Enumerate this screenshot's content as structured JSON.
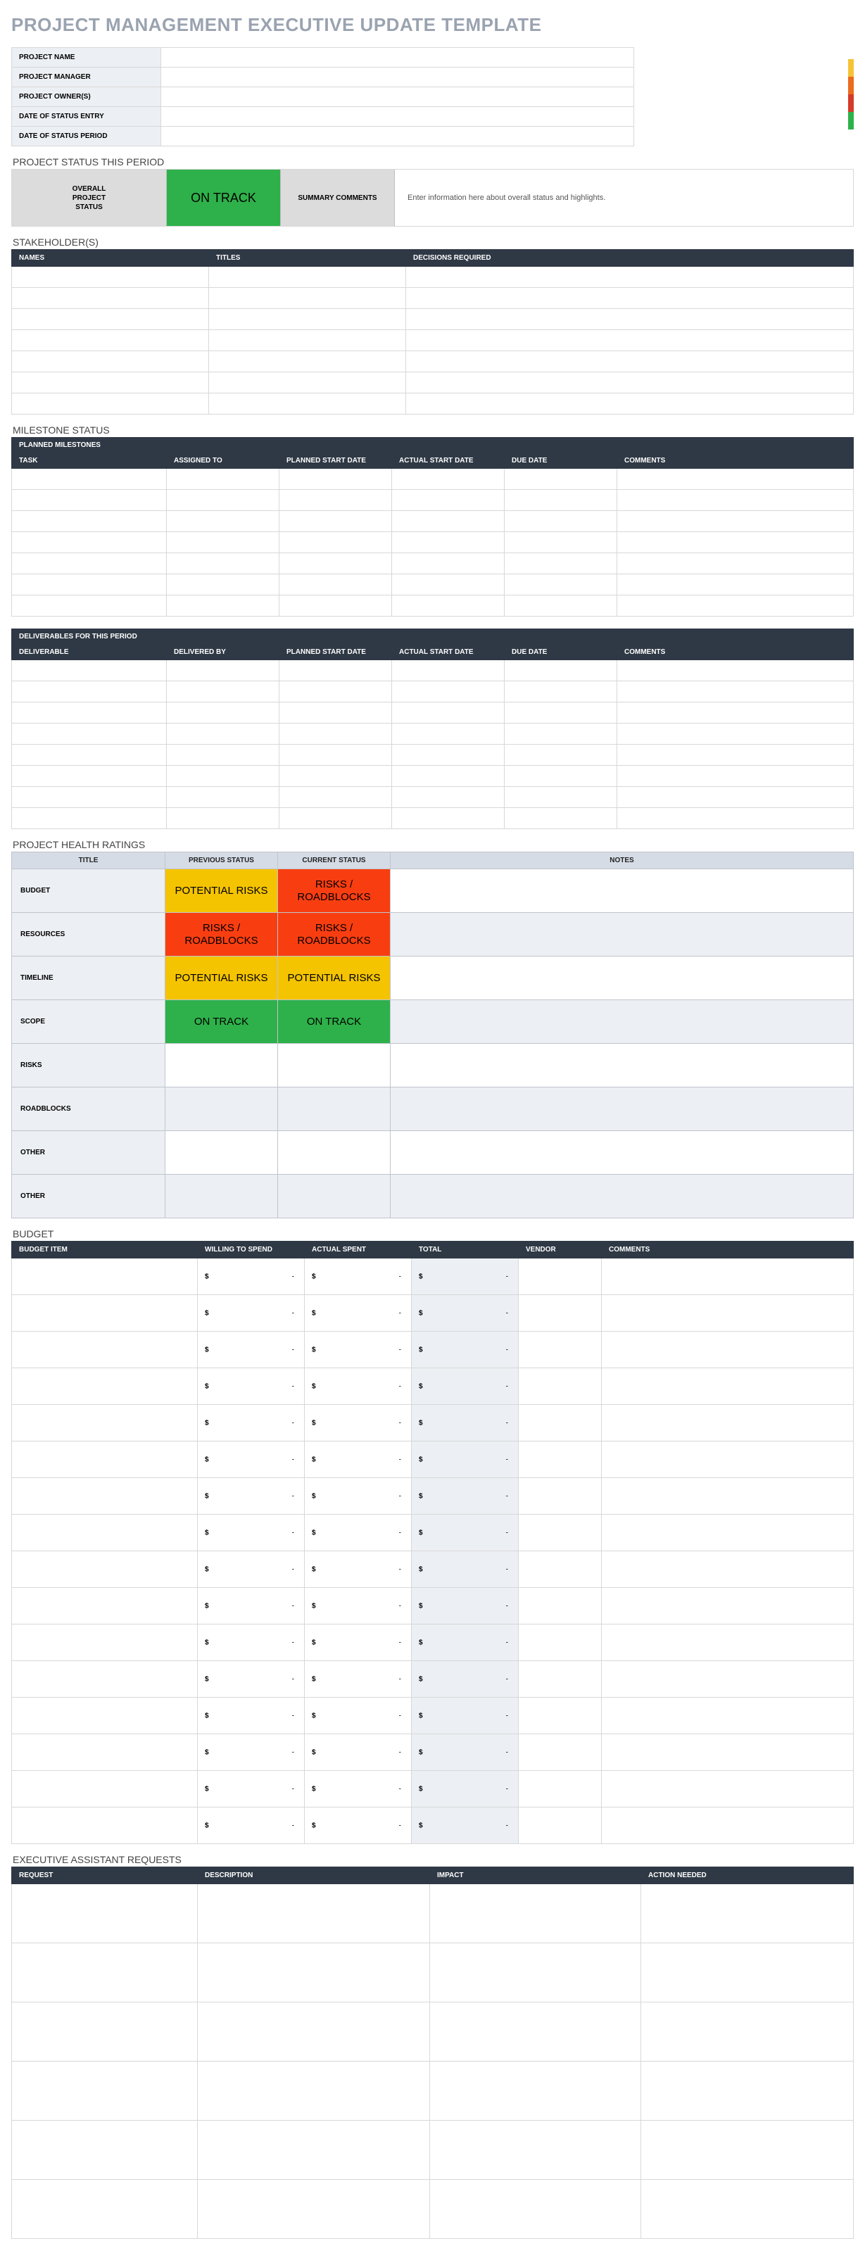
{
  "title": "PROJECT MANAGEMENT EXECUTIVE UPDATE TEMPLATE",
  "info": {
    "rows": [
      {
        "label": "PROJECT NAME",
        "value": ""
      },
      {
        "label": "PROJECT MANAGER",
        "value": ""
      },
      {
        "label": "PROJECT OWNER(S)",
        "value": ""
      },
      {
        "label": "DATE OF STATUS ENTRY",
        "value": ""
      },
      {
        "label": "DATE OF STATUS PERIOD",
        "value": ""
      }
    ]
  },
  "status_period": {
    "label": "PROJECT STATUS THIS PERIOD",
    "overall_label": "OVERALL\nPROJECT\nSTATUS",
    "status_text": "ON TRACK",
    "status_class": "green",
    "summary_label": "SUMMARY COMMENTS",
    "summary_value": "Enter information here about overall status and highlights."
  },
  "stakeholders": {
    "label": "STAKEHOLDER(S)",
    "headers": [
      "NAMES",
      "TITLES",
      "DECISIONS REQUIRED"
    ],
    "widths": [
      "280px",
      "280px",
      "auto"
    ],
    "rows": 7
  },
  "milestones": {
    "label": "MILESTONE STATUS",
    "subheads": {
      "planned": "PLANNED MILESTONES",
      "deliv": "DELIVERABLES FOR THIS PERIOD"
    },
    "headers_planned": [
      "TASK",
      "ASSIGNED TO",
      "PLANNED START DATE",
      "ACTUAL START DATE",
      "DUE DATE",
      "COMMENTS"
    ],
    "headers_deliv": [
      "DELIVERABLE",
      "DELIVERED BY",
      "PLANNED START DATE",
      "ACTUAL START DATE",
      "DUE DATE",
      "COMMENTS"
    ],
    "widths": [
      "220px",
      "160px",
      "160px",
      "160px",
      "160px",
      "auto"
    ],
    "rows_planned": 7,
    "rows_deliv": 8
  },
  "health": {
    "label": "PROJECT HEALTH RATINGS",
    "headers": [
      "TITLE",
      "PREVIOUS STATUS",
      "CURRENT STATUS",
      "NOTES"
    ],
    "rows": [
      {
        "title": "BUDGET",
        "prev": "POTENTIAL RISKS",
        "prev_class": "yellow",
        "curr": "RISKS / ROADBLOCKS",
        "curr_class": "red",
        "alt": false
      },
      {
        "title": "RESOURCES",
        "prev": "RISKS / ROADBLOCKS",
        "prev_class": "red",
        "curr": "RISKS / ROADBLOCKS",
        "curr_class": "red",
        "alt": true
      },
      {
        "title": "TIMELINE",
        "prev": "POTENTIAL RISKS",
        "prev_class": "yellow",
        "curr": "POTENTIAL RISKS",
        "curr_class": "yellow",
        "alt": false
      },
      {
        "title": "SCOPE",
        "prev": "ON TRACK",
        "prev_class": "green",
        "curr": "ON TRACK",
        "curr_class": "green",
        "alt": true
      },
      {
        "title": "RISKS",
        "prev": "",
        "prev_class": "",
        "curr": "",
        "curr_class": "",
        "alt": false
      },
      {
        "title": "ROADBLOCKS",
        "prev": "",
        "prev_class": "",
        "curr": "",
        "curr_class": "",
        "alt": true
      },
      {
        "title": "OTHER",
        "prev": "",
        "prev_class": "",
        "curr": "",
        "curr_class": "",
        "alt": false
      },
      {
        "title": "OTHER",
        "prev": "",
        "prev_class": "",
        "curr": "",
        "curr_class": "",
        "alt": true
      }
    ]
  },
  "budget": {
    "label": "BUDGET",
    "headers": [
      "BUDGET ITEM",
      "WILLING TO SPEND",
      "ACTUAL SPENT",
      "TOTAL",
      "VENDOR",
      "COMMENTS"
    ],
    "widths": [
      "264px",
      "152px",
      "152px",
      "152px",
      "118px",
      "auto"
    ],
    "rows": 16,
    "sym": "$",
    "dash": "-"
  },
  "requests": {
    "label": "EXECUTIVE ASSISTANT REQUESTS",
    "headers": [
      "REQUEST",
      "DESCRIPTION",
      "IMPACT",
      "ACTION NEEDED"
    ],
    "widths": [
      "264px",
      "330px",
      "300px",
      "auto"
    ],
    "rows": 6
  }
}
